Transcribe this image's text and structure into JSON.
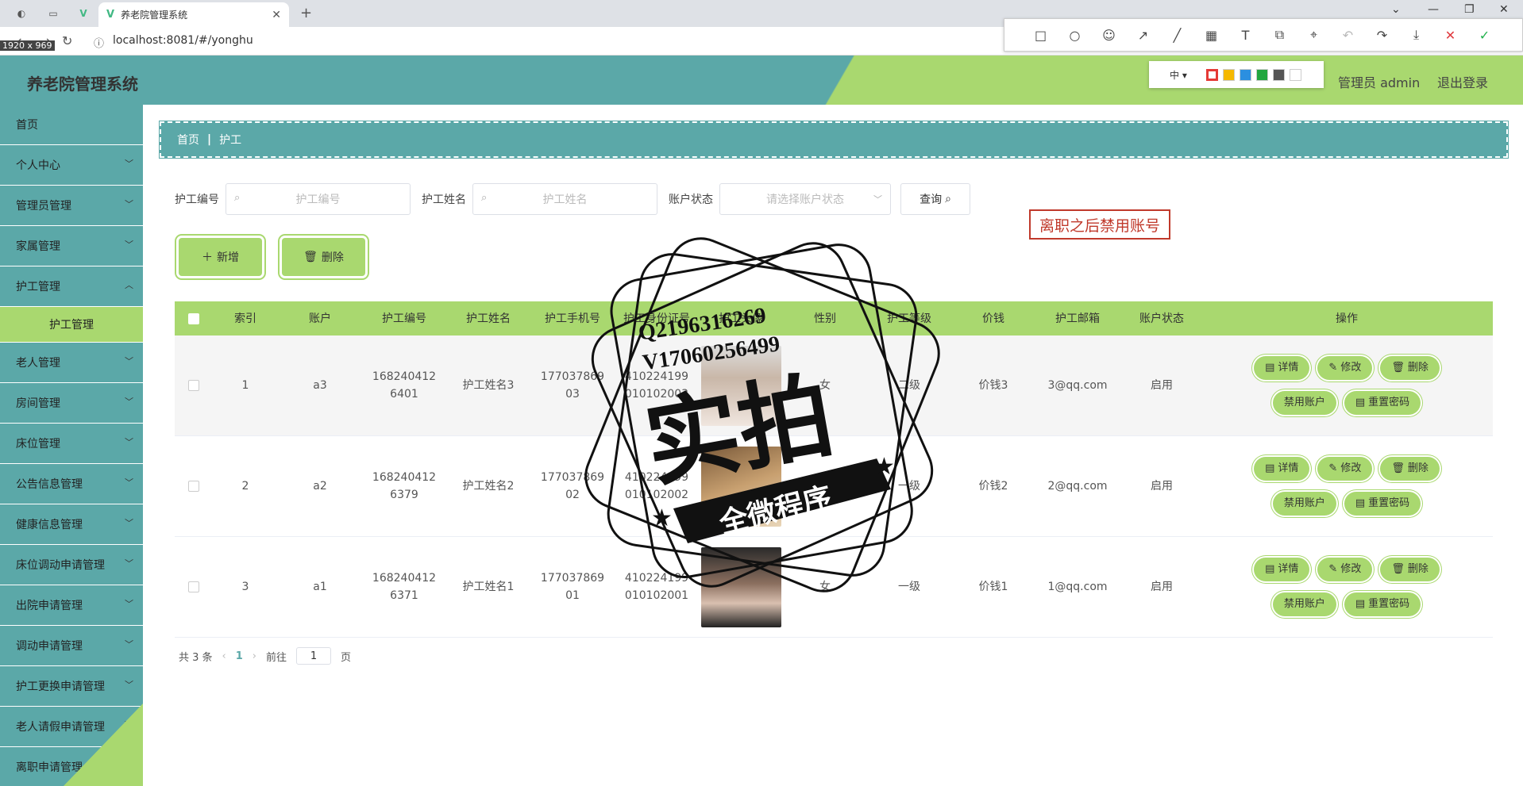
{
  "browser": {
    "tab_title": "养老院管理系统",
    "url": "localhost:8081/#/yonghu",
    "dims": "1920 x 969",
    "tab_logo": "V"
  },
  "shot_tool": {
    "size": "中 ▾",
    "swatches": [
      "#e53935",
      "#f5b800",
      "#2b8fe0",
      "#21a63f",
      "#555555",
      "#ffffff"
    ],
    "icons": [
      "rect-icon",
      "ellipse-icon",
      "emoji-icon",
      "arrow-icon",
      "line-icon",
      "mosaic-icon",
      "text-icon",
      "copy-icon",
      "ocr-icon",
      "undo-icon",
      "share-icon",
      "download-icon",
      "close-icon",
      "check-icon"
    ]
  },
  "header": {
    "title": "养老院管理系统",
    "user": "管理员 admin",
    "logout": "退出登录"
  },
  "sidebar": {
    "items": [
      {
        "label": "首页"
      },
      {
        "label": "个人中心"
      },
      {
        "label": "管理员管理"
      },
      {
        "label": "家属管理"
      },
      {
        "label": "护工管理"
      },
      {
        "label": "护工管理",
        "sub": true
      },
      {
        "label": "老人管理"
      },
      {
        "label": "房间管理"
      },
      {
        "label": "床位管理"
      },
      {
        "label": "公告信息管理"
      },
      {
        "label": "健康信息管理"
      },
      {
        "label": "床位调动申请管理"
      },
      {
        "label": "出院申请管理"
      },
      {
        "label": "调动申请管理"
      },
      {
        "label": "护工更换申请管理"
      },
      {
        "label": "老人请假申请管理"
      },
      {
        "label": "离职申请管理"
      }
    ]
  },
  "breadcrumb": {
    "home": "首页",
    "current": "护工"
  },
  "search": {
    "no_label": "护工编号",
    "no_placeholder": "护工编号",
    "name_label": "护工姓名",
    "name_placeholder": "护工姓名",
    "status_label": "账户状态",
    "status_placeholder": "请选择账户状态",
    "query": "查询"
  },
  "annotation": "离职之后禁用账号",
  "actions": {
    "add": "新增",
    "delete": "删除"
  },
  "table": {
    "headers": [
      "索引",
      "账户",
      "护工编号",
      "护工姓名",
      "护工手机号",
      "护工身份证号",
      "护工头像",
      "性别",
      "护工等级",
      "价钱",
      "护工邮箱",
      "账户状态",
      "操作"
    ],
    "rows": [
      {
        "idx": "1",
        "acc": "a3",
        "no": "1682404126401",
        "name": "护工姓名3",
        "phone": "17703786903",
        "id": "410224199010102003",
        "sex": "女",
        "level": "二级",
        "price": "价钱3",
        "mail": "3@qq.com",
        "status": "启用"
      },
      {
        "idx": "2",
        "acc": "a2",
        "no": "1682404126379",
        "name": "护工姓名2",
        "phone": "17703786902",
        "id": "410224199010102002",
        "sex": "男",
        "level": "一级",
        "price": "价钱2",
        "mail": "2@qq.com",
        "status": "启用"
      },
      {
        "idx": "3",
        "acc": "a1",
        "no": "1682404126371",
        "name": "护工姓名1",
        "phone": "17703786901",
        "id": "410224199010102001",
        "sex": "女",
        "level": "一级",
        "price": "价钱1",
        "mail": "1@qq.com",
        "status": "启用"
      }
    ],
    "ops": {
      "detail": "详情",
      "edit": "修改",
      "delete": "删除",
      "disable": "禁用账户",
      "reset": "重置密码"
    }
  },
  "pager": {
    "total": "共 3 条",
    "page": "1",
    "goto": "前往",
    "goto_val": "1",
    "unit": "页"
  },
  "watermark": {
    "line1": "Q2196316269",
    "line2": "V17060256499",
    "big": "实拍",
    "ribbon": "全微程序"
  }
}
